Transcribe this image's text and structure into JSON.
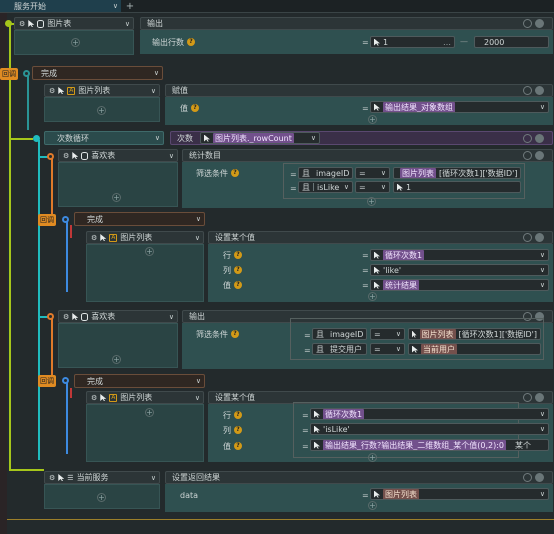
{
  "tabs": {
    "active": "服务开始",
    "add": "+"
  },
  "lines": {
    "hard": "=",
    "ellipsis": "…",
    "dash": "—",
    "chev": "∨",
    "q": "?",
    "plus": "+"
  },
  "nodes": {
    "n1": {
      "source": "图片表",
      "action": "输出",
      "param": "输出行数",
      "op": "=",
      "v1": "1",
      "v2": "2000"
    },
    "n2": {
      "state": "完成",
      "badge": "回调"
    },
    "n3": {
      "source": "图片列表",
      "action": "赋值",
      "param": "值",
      "op": "=",
      "val": "输出结果_对象数组"
    },
    "n4": {
      "mode": "次数循环",
      "label": "次数",
      "expr": "图片列表._rowCount",
      "suffix": "∨"
    },
    "n5": {
      "source": "喜欢表",
      "action": "统计数目",
      "param": "筛选条件",
      "conds": [
        {
          "prefix": "且",
          "field": "imageID",
          "op": "=",
          "val_tag": "图片列表",
          "val_rest": "[循环次数1]['数据ID']"
        },
        {
          "prefix": "且",
          "field": "isLike",
          "op": "=",
          "val": "1"
        }
      ]
    },
    "n6": {
      "state": "完成",
      "badge": "回调"
    },
    "n7": {
      "source": "图片列表",
      "action": "设置某个值",
      "rows": [
        {
          "label": "行",
          "op": "=",
          "val": "循环次数1",
          "tagged": true
        },
        {
          "label": "列",
          "op": "=",
          "val": "'like'",
          "tagged": false
        },
        {
          "label": "值",
          "op": "=",
          "val": "统计结果",
          "tagged": true
        }
      ]
    },
    "n8": {
      "source": "喜欢表",
      "action": "输出",
      "param": "筛选条件",
      "conds": [
        {
          "prefix": "且",
          "field": "imageID",
          "op": "=",
          "val_tag": "图片列表",
          "val_rest": "[循环次数1]['数据ID']"
        },
        {
          "prefix": "且",
          "field": "提交用户",
          "op": "=",
          "val_tag": "当前用户",
          "val_rest": ""
        }
      ]
    },
    "n9": {
      "state": "完成",
      "badge": "回调"
    },
    "n10": {
      "source": "图片列表",
      "action": "设置某个值",
      "rows": [
        {
          "label": "行",
          "op": "=",
          "val": "循环次数1",
          "tagged": true
        },
        {
          "label": "列",
          "op": "=",
          "val": "'isLike'",
          "tagged": false
        },
        {
          "label": "值",
          "op": "=",
          "val": "输出结果_行数?输出结果_二维数组_某个值(0,2):0",
          "trail": "某个",
          "tagged": false
        }
      ]
    },
    "n11": {
      "source": "当前服务",
      "action": "设置返回结果",
      "param": "data",
      "op": "=",
      "val": "图片列表"
    }
  },
  "colors": {
    "bg": "#232a2c",
    "header": "#2c3537",
    "accent_lime": "#a6c61b",
    "accent_cyan": "#20bcbe",
    "accent_orange": "#e07a2a",
    "accent_blue": "#3d8ae0",
    "tag_purple": "#72508c",
    "callback": "#e08b22"
  }
}
